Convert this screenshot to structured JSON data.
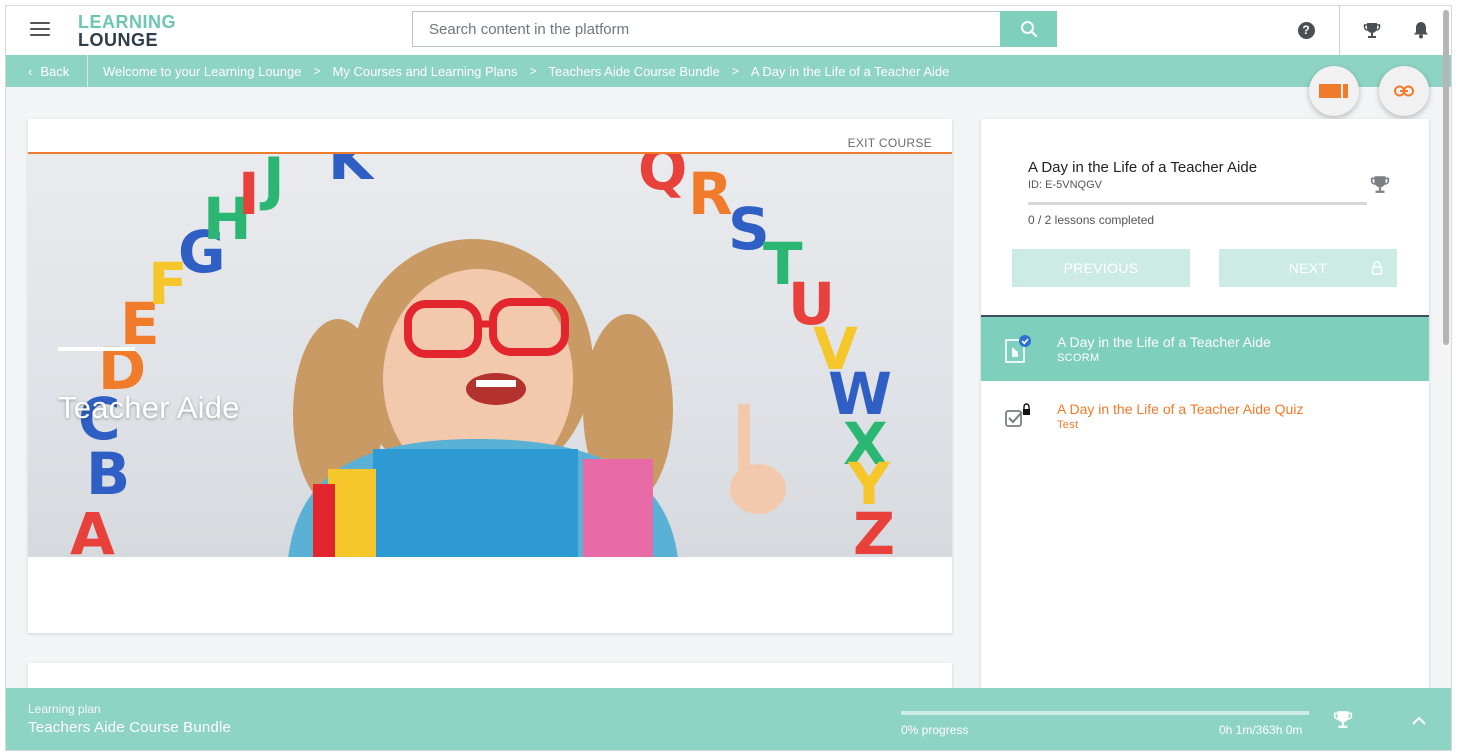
{
  "app": {
    "logo_line1": "LEARNING",
    "logo_line2": "LOUNGE",
    "brand_color": "#7fcfbd",
    "accent_color": "#f07b2a"
  },
  "header": {
    "search": {
      "placeholder": "Search content in the platform",
      "value": ""
    },
    "icons": [
      "menu-icon",
      "search-icon",
      "help-icon",
      "trophy-icon",
      "bell-icon"
    ]
  },
  "breadcrumb": {
    "back_label": "Back",
    "items": [
      "Welcome to your Learning Lounge",
      "My Courses and Learning Plans",
      "Teachers Aide Course Bundle",
      "A Day in the Life of a Teacher Aide"
    ],
    "separator": ">"
  },
  "floating_actions": [
    "video-icon",
    "link-icon"
  ],
  "player": {
    "exit_label": "EXIT COURSE",
    "hero_title": "Teacher Aide"
  },
  "course_panel": {
    "title": "A Day in the Life of a Teacher Aide",
    "id_label": "ID: E-5VNQGV",
    "lessons_completed": "0 / 2 lessons completed",
    "completion_fraction": 0,
    "previous_label": "PREVIOUS",
    "next_label": "NEXT",
    "lessons": [
      {
        "title": "A Day in the Life of a Teacher Aide",
        "type": "SCORM",
        "status": "active",
        "icon": "scorm-file-icon"
      },
      {
        "title": "A Day in the Life of a Teacher Aide Quiz",
        "type": "Test",
        "status": "locked",
        "icon": "test-checkbox-icon"
      }
    ]
  },
  "learning_plan_bar": {
    "label": "Learning plan",
    "name": "Teachers Aide Course Bundle",
    "progress_text": "0% progress",
    "progress_fraction": 0,
    "time_text": "0h 1m/363h 0m"
  }
}
